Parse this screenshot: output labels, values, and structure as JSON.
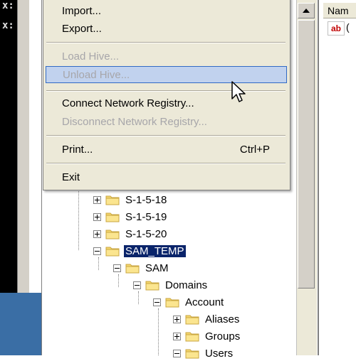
{
  "console": {
    "lines": [
      "x:",
      "x:"
    ]
  },
  "file_menu": {
    "items": [
      {
        "label": "Import...",
        "shortcut": "",
        "state": "enabled"
      },
      {
        "label": "Export...",
        "shortcut": "",
        "state": "enabled"
      },
      {
        "label": "Load Hive...",
        "shortcut": "",
        "state": "disabled"
      },
      {
        "label": "Unload Hive...",
        "shortcut": "",
        "state": "disabled-highlighted"
      },
      {
        "label": "Connect Network Registry...",
        "shortcut": "",
        "state": "enabled"
      },
      {
        "label": "Disconnect Network Registry...",
        "shortcut": "",
        "state": "disabled"
      },
      {
        "label": "Print...",
        "shortcut": "Ctrl+P",
        "state": "enabled"
      },
      {
        "label": "Exit",
        "shortcut": "",
        "state": "enabled"
      }
    ]
  },
  "tree": {
    "nodes": [
      {
        "label": "S-1-5-18",
        "expander": "plus",
        "depth": 0
      },
      {
        "label": "S-1-5-19",
        "expander": "plus",
        "depth": 0
      },
      {
        "label": "S-1-5-20",
        "expander": "plus",
        "depth": 0
      },
      {
        "label": "SAM_TEMP",
        "expander": "minus",
        "depth": 0,
        "selected": true
      },
      {
        "label": "SAM",
        "expander": "minus",
        "depth": 1
      },
      {
        "label": "Domains",
        "expander": "minus",
        "depth": 2
      },
      {
        "label": "Account",
        "expander": "minus",
        "depth": 3
      },
      {
        "label": "Aliases",
        "expander": "plus",
        "depth": 4
      },
      {
        "label": "Groups",
        "expander": "plus",
        "depth": 4
      },
      {
        "label": "Users",
        "expander": "minus",
        "depth": 4
      }
    ]
  },
  "values_pane": {
    "column_header": "Nam",
    "row_icon": "ab",
    "row_text": "("
  },
  "icons": {
    "folder": "folder-icon",
    "string_value": "string-value-icon",
    "cursor": "mouse-pointer-icon"
  },
  "colors": {
    "selection": "#0a246a",
    "menu_highlight": "#c1d2ee",
    "menu_background": "#ece9d8",
    "disabled_text": "#a7a6aa",
    "folder": "#f5d76e"
  }
}
